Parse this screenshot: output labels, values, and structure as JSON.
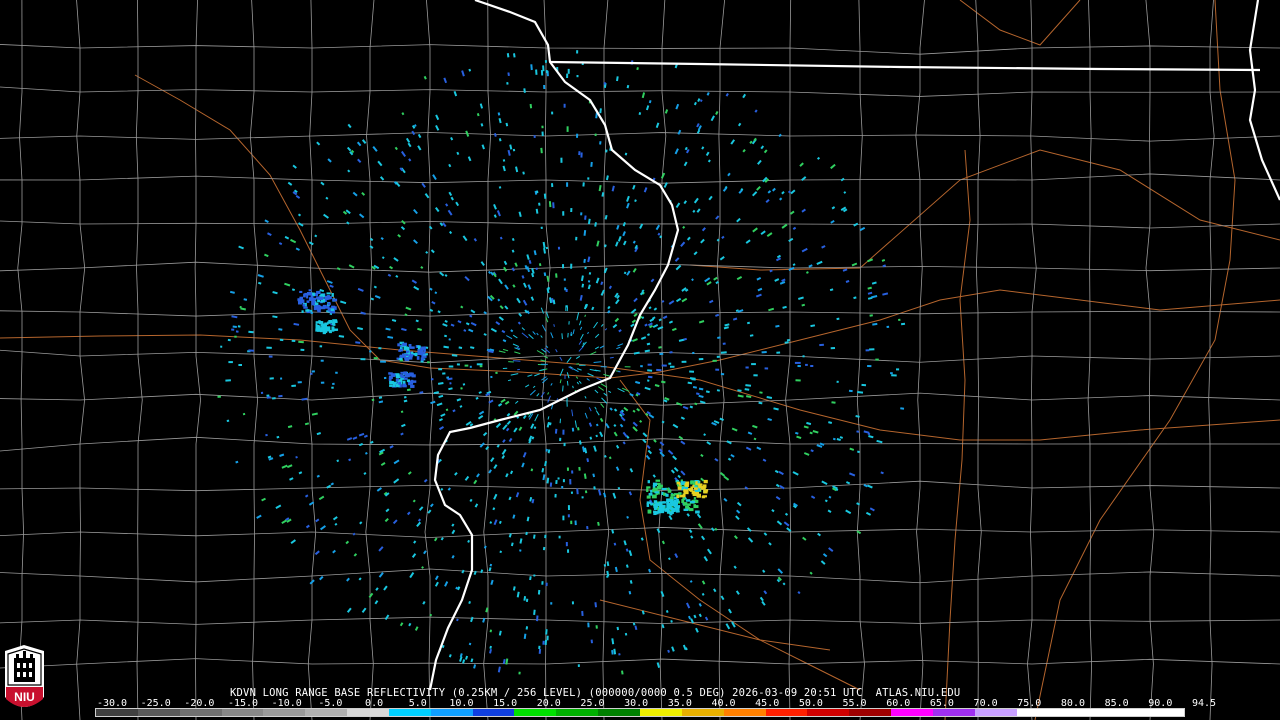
{
  "product": {
    "caption": "KDVN LONG RANGE BASE REFLECTIVITY (0.25KM / 256 LEVEL) (000000/0000 0.5 DEG) 2026-03-09 20:51 UTC  ATLAS.NIU.EDU"
  },
  "logo": {
    "text": "NIU"
  },
  "colors": {
    "background": "#000000",
    "county_lines": "#9a9a9a",
    "state_lines": "#ffffff",
    "roads": "#b5652d",
    "radar_cyan": "#19c8e0",
    "radar_blue": "#2860e0",
    "radar_green": "#30d060",
    "radar_yellow": "#e8d020"
  },
  "scale": {
    "labels": [
      "-30.0",
      "-25.0",
      "-20.0",
      "-15.0",
      "-10.0",
      "-5.0",
      "0.0",
      "5.0",
      "10.0",
      "15.0",
      "20.0",
      "25.0",
      "30.0",
      "35.0",
      "40.0",
      "45.0",
      "50.0",
      "55.0",
      "60.0",
      "65.0",
      "70.0",
      "75.0",
      "80.0",
      "85.0",
      "90.0",
      "94.5"
    ],
    "colors": [
      "#404040",
      "#5a5a5a",
      "#707070",
      "#888888",
      "#9a9a9a",
      "#b0b0b0",
      "#d8d8d8",
      "#00d0ff",
      "#10a0ff",
      "#1040e0",
      "#00e000",
      "#00b000",
      "#008000",
      "#f0f000",
      "#e8b000",
      "#ff8000",
      "#ff2000",
      "#d00000",
      "#a00000",
      "#ff00ff",
      "#a030f0",
      "#c8a0ff",
      "#ffffff",
      "#ffffff",
      "#ffffff",
      "#ffffff"
    ]
  }
}
